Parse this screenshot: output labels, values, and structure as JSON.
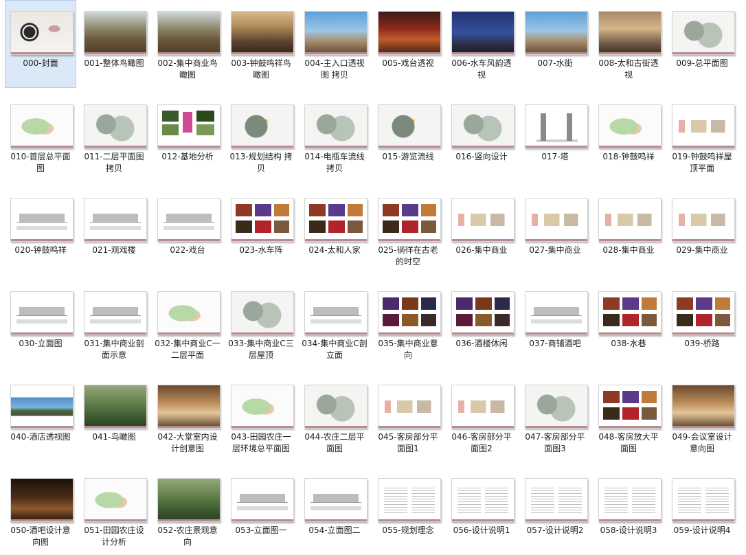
{
  "selected_item": "000-封面",
  "items": [
    {
      "label": "000-封面",
      "thumb": "t-cover"
    },
    {
      "label": "001-整体鸟瞰图",
      "thumb": "t-photo-day"
    },
    {
      "label": "002-集中商业鸟瞰图",
      "thumb": "t-photo-day"
    },
    {
      "label": "003-钟鼓鸣祥鸟瞰图",
      "thumb": "t-photo-dusk"
    },
    {
      "label": "004-主入口透视图 拷贝",
      "thumb": "t-photo-sky"
    },
    {
      "label": "005-戏台透视",
      "thumb": "t-photo-red"
    },
    {
      "label": "006-水车风韵透视",
      "thumb": "t-photo-blue"
    },
    {
      "label": "007-水街",
      "thumb": "t-photo-sky"
    },
    {
      "label": "008-太和古街透视",
      "thumb": "t-photo-warm"
    },
    {
      "label": "009-总平面图",
      "thumb": "t-plan"
    },
    {
      "label": "010-首层总平面图",
      "thumb": "t-plan-green"
    },
    {
      "label": "011-二层平面图 拷贝",
      "thumb": "t-plan"
    },
    {
      "label": "012-基地分析",
      "thumb": "t-site"
    },
    {
      "label": "013-规划结构 拷贝",
      "thumb": "t-plan-color"
    },
    {
      "label": "014-电瓶车流线 拷贝",
      "thumb": "t-plan"
    },
    {
      "label": "015-游览流线",
      "thumb": "t-plan-color"
    },
    {
      "label": "016-竖向设计",
      "thumb": "t-plan"
    },
    {
      "label": "017-塔",
      "thumb": "t-tower"
    },
    {
      "label": "018-钟鼓鸣祥",
      "thumb": "t-plan-green"
    },
    {
      "label": "019-钟鼓鸣祥屋顶平面",
      "thumb": "t-plan-pink"
    },
    {
      "label": "020-钟鼓鸣祥",
      "thumb": "t-elev"
    },
    {
      "label": "021-观戏楼",
      "thumb": "t-elev"
    },
    {
      "label": "022-戏台",
      "thumb": "t-elev"
    },
    {
      "label": "023-水车阵",
      "thumb": "t-collage"
    },
    {
      "label": "024-太和人家",
      "thumb": "t-collage"
    },
    {
      "label": "025-徜徉在古老的时空",
      "thumb": "t-collage"
    },
    {
      "label": "026-集中商业",
      "thumb": "t-plan-pink"
    },
    {
      "label": "027-集中商业",
      "thumb": "t-plan-pink"
    },
    {
      "label": "028-集中商业",
      "thumb": "t-plan-pink"
    },
    {
      "label": "029-集中商业",
      "thumb": "t-plan-pink"
    },
    {
      "label": "030-立面图",
      "thumb": "t-elev"
    },
    {
      "label": "031-集中商业剖面示意",
      "thumb": "t-elev"
    },
    {
      "label": "032-集中商业C一二层平面",
      "thumb": "t-plan-green"
    },
    {
      "label": "033-集中商业C三层屋顶",
      "thumb": "t-plan"
    },
    {
      "label": "034-集中商业C剖立面",
      "thumb": "t-elev"
    },
    {
      "label": "035-集中商业意向",
      "thumb": "t-collage-night"
    },
    {
      "label": "036-酒楼休闲",
      "thumb": "t-collage-night"
    },
    {
      "label": "037-商铺酒吧",
      "thumb": "t-elev"
    },
    {
      "label": "038-水巷",
      "thumb": "t-collage"
    },
    {
      "label": "039-桥路",
      "thumb": "t-collage"
    },
    {
      "label": "040-酒店透视图",
      "thumb": "t-photo-pano"
    },
    {
      "label": "041-鸟瞰图",
      "thumb": "t-photo-green"
    },
    {
      "label": "042-大堂室内设计创意图",
      "thumb": "t-interior"
    },
    {
      "label": "043-田园农庄一层环境总平面图",
      "thumb": "t-plan-green"
    },
    {
      "label": "044-农庄二层平面图",
      "thumb": "t-plan"
    },
    {
      "label": "045-客房部分平面图1",
      "thumb": "t-plan-pink"
    },
    {
      "label": "046-客房部分平面图2",
      "thumb": "t-plan-pink"
    },
    {
      "label": "047-客房部分平面图3",
      "thumb": "t-plan"
    },
    {
      "label": "048-客房放大平面图",
      "thumb": "t-collage"
    },
    {
      "label": "049-会议室设计意向图",
      "thumb": "t-interior"
    },
    {
      "label": "050-酒吧设计意向图",
      "thumb": "t-interior-dark"
    },
    {
      "label": "051-田园农庄设计分析",
      "thumb": "t-plan-green"
    },
    {
      "label": "052-农庄景观意向",
      "thumb": "t-photo-green"
    },
    {
      "label": "053-立面图一",
      "thumb": "t-elev"
    },
    {
      "label": "054-立面图二",
      "thumb": "t-elev"
    },
    {
      "label": "055-规划理念",
      "thumb": "t-text"
    },
    {
      "label": "056-设计说明1",
      "thumb": "t-text"
    },
    {
      "label": "057-设计说明2",
      "thumb": "t-text"
    },
    {
      "label": "058-设计说明3",
      "thumb": "t-text"
    },
    {
      "label": "059-设计说明4",
      "thumb": "t-text"
    }
  ]
}
